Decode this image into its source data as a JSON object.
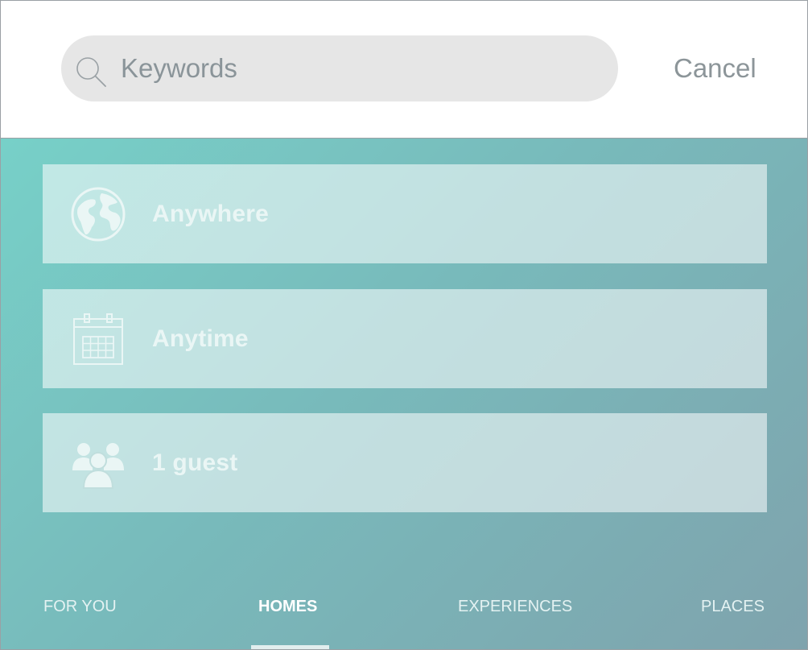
{
  "search": {
    "placeholder": "Keywords",
    "value": "",
    "cancel_label": "Cancel"
  },
  "filters": [
    {
      "icon": "globe-icon",
      "label": "Anywhere"
    },
    {
      "icon": "calendar-icon",
      "label": "Anytime"
    },
    {
      "icon": "people-icon",
      "label": "1 guest"
    }
  ],
  "tabs": [
    {
      "label": "FOR YOU",
      "active": false
    },
    {
      "label": "HOMES",
      "active": true
    },
    {
      "label": "EXPERIENCES",
      "active": false
    },
    {
      "label": "PLACES",
      "active": false
    }
  ],
  "colors": {
    "gradient_start": "#77d0c8",
    "gradient_end": "#7fa3ad",
    "search_bg": "#e6e6e6",
    "muted_text": "#8c9599"
  }
}
